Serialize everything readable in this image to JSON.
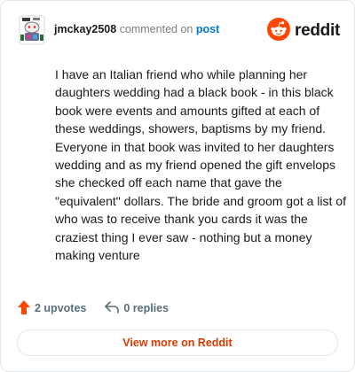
{
  "header": {
    "username": "jmckay2508",
    "commented_on": "commented on",
    "post_link": "post",
    "brand_name": "reddit",
    "avatar_icon": "snoo-avatar-icon",
    "brand_icon": "reddit-logo-icon"
  },
  "comment": {
    "body": "I have an Italian friend who while planning her daughters wedding had a black book - in this black book were events and amounts gifted at each of these weddings, showers, baptisms by my friend. Everyone in that book was invited to her daughters wedding and as my friend opened the gift envelops she checked off each name that gave the \"equivalent\" dollars. The bride and groom got a list of who was to receive thank you cards it was the craziest thing I ever saw - nothing but a money making venture"
  },
  "actions": {
    "upvotes": "2 upvotes",
    "replies": "0 replies",
    "upvote_icon": "upvote-arrow-icon",
    "reply_icon": "reply-icon"
  },
  "footer": {
    "view_more": "View more on Reddit"
  },
  "colors": {
    "brand_orange": "#ff4500",
    "link_blue": "#0079d3",
    "view_more_text": "#d93a00",
    "muted_text": "#576f76",
    "border": "#e3e6e8"
  }
}
